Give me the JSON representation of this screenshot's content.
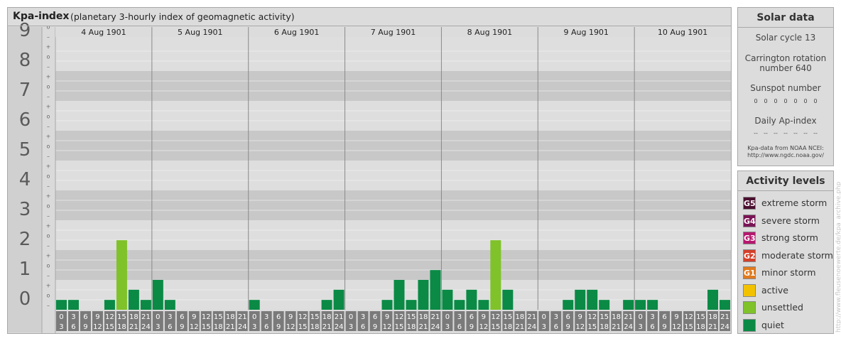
{
  "header": {
    "title": "Kpa-index",
    "subtitle": "(planetary 3-hourly index of geomagnetic activity)"
  },
  "solar": {
    "title": "Solar data",
    "cycle": "Solar cycle 13",
    "carrington_line1": "Carrington rotation",
    "carrington_line2": "number 640",
    "sunspot_label": "Sunspot number",
    "sunspot_values": [
      "0",
      "0",
      "0",
      "0",
      "0",
      "0",
      "0"
    ],
    "ap_label": "Daily Ap-index",
    "ap_values": [
      "--",
      "--",
      "--",
      "--",
      "--",
      "--",
      "--"
    ],
    "source_line1": "Kpa-data from NOAA NCEI:",
    "source_line2": "http://www.ngdc.noaa.gov/"
  },
  "levels": {
    "title": "Activity levels",
    "items": [
      {
        "code": "G5",
        "label": "extreme storm",
        "color": "#4a0f2e"
      },
      {
        "code": "G4",
        "label": "severe storm",
        "color": "#7a1455"
      },
      {
        "code": "G3",
        "label": "strong storm",
        "color": "#b5186e"
      },
      {
        "code": "G2",
        "label": "moderate storm",
        "color": "#d4402a"
      },
      {
        "code": "G1",
        "label": "minor storm",
        "color": "#e07a1e"
      },
      {
        "code": "",
        "label": "active",
        "color": "#f2c200"
      },
      {
        "code": "",
        "label": "unsettled",
        "color": "#7fc22a"
      },
      {
        "code": "",
        "label": "quiet",
        "color": "#0a8a45"
      }
    ]
  },
  "credit": "http://www.fleusenoewerte.de/kpa_archive.php",
  "chart_data": {
    "type": "bar",
    "ylim": [
      0,
      9
    ],
    "y_ticks": [
      "0",
      "1",
      "2",
      "3",
      "4",
      "5",
      "6",
      "7",
      "8",
      "9"
    ],
    "y_subticks": [
      "+",
      "o",
      "–"
    ],
    "days": [
      "4 Aug 1901",
      "5 Aug 1901",
      "6 Aug 1901",
      "7 Aug 1901",
      "8 Aug 1901",
      "9 Aug 1901",
      "10 Aug 1901"
    ],
    "hour_start": [
      "0",
      "3",
      "6",
      "9",
      "12",
      "15",
      "18",
      "21"
    ],
    "hour_end": [
      "3",
      "6",
      "9",
      "12",
      "15",
      "18",
      "21",
      "24"
    ],
    "values": [
      [
        0.33,
        0.33,
        0,
        0,
        0.33,
        2.33,
        0.67,
        0.33
      ],
      [
        1,
        0.33,
        0,
        0,
        0,
        0,
        0,
        0
      ],
      [
        0.33,
        0,
        0,
        0,
        0,
        0,
        0.33,
        0.67
      ],
      [
        0,
        0,
        0,
        0.33,
        1,
        0.33,
        1,
        1.33
      ],
      [
        0.67,
        0.33,
        0.67,
        0.33,
        2.33,
        0.67,
        0,
        0
      ],
      [
        0,
        0,
        0.33,
        0.67,
        0.67,
        0.33,
        0,
        0.33
      ],
      [
        0.33,
        0.33,
        0,
        0,
        0,
        0,
        0.67,
        0.33
      ]
    ]
  }
}
